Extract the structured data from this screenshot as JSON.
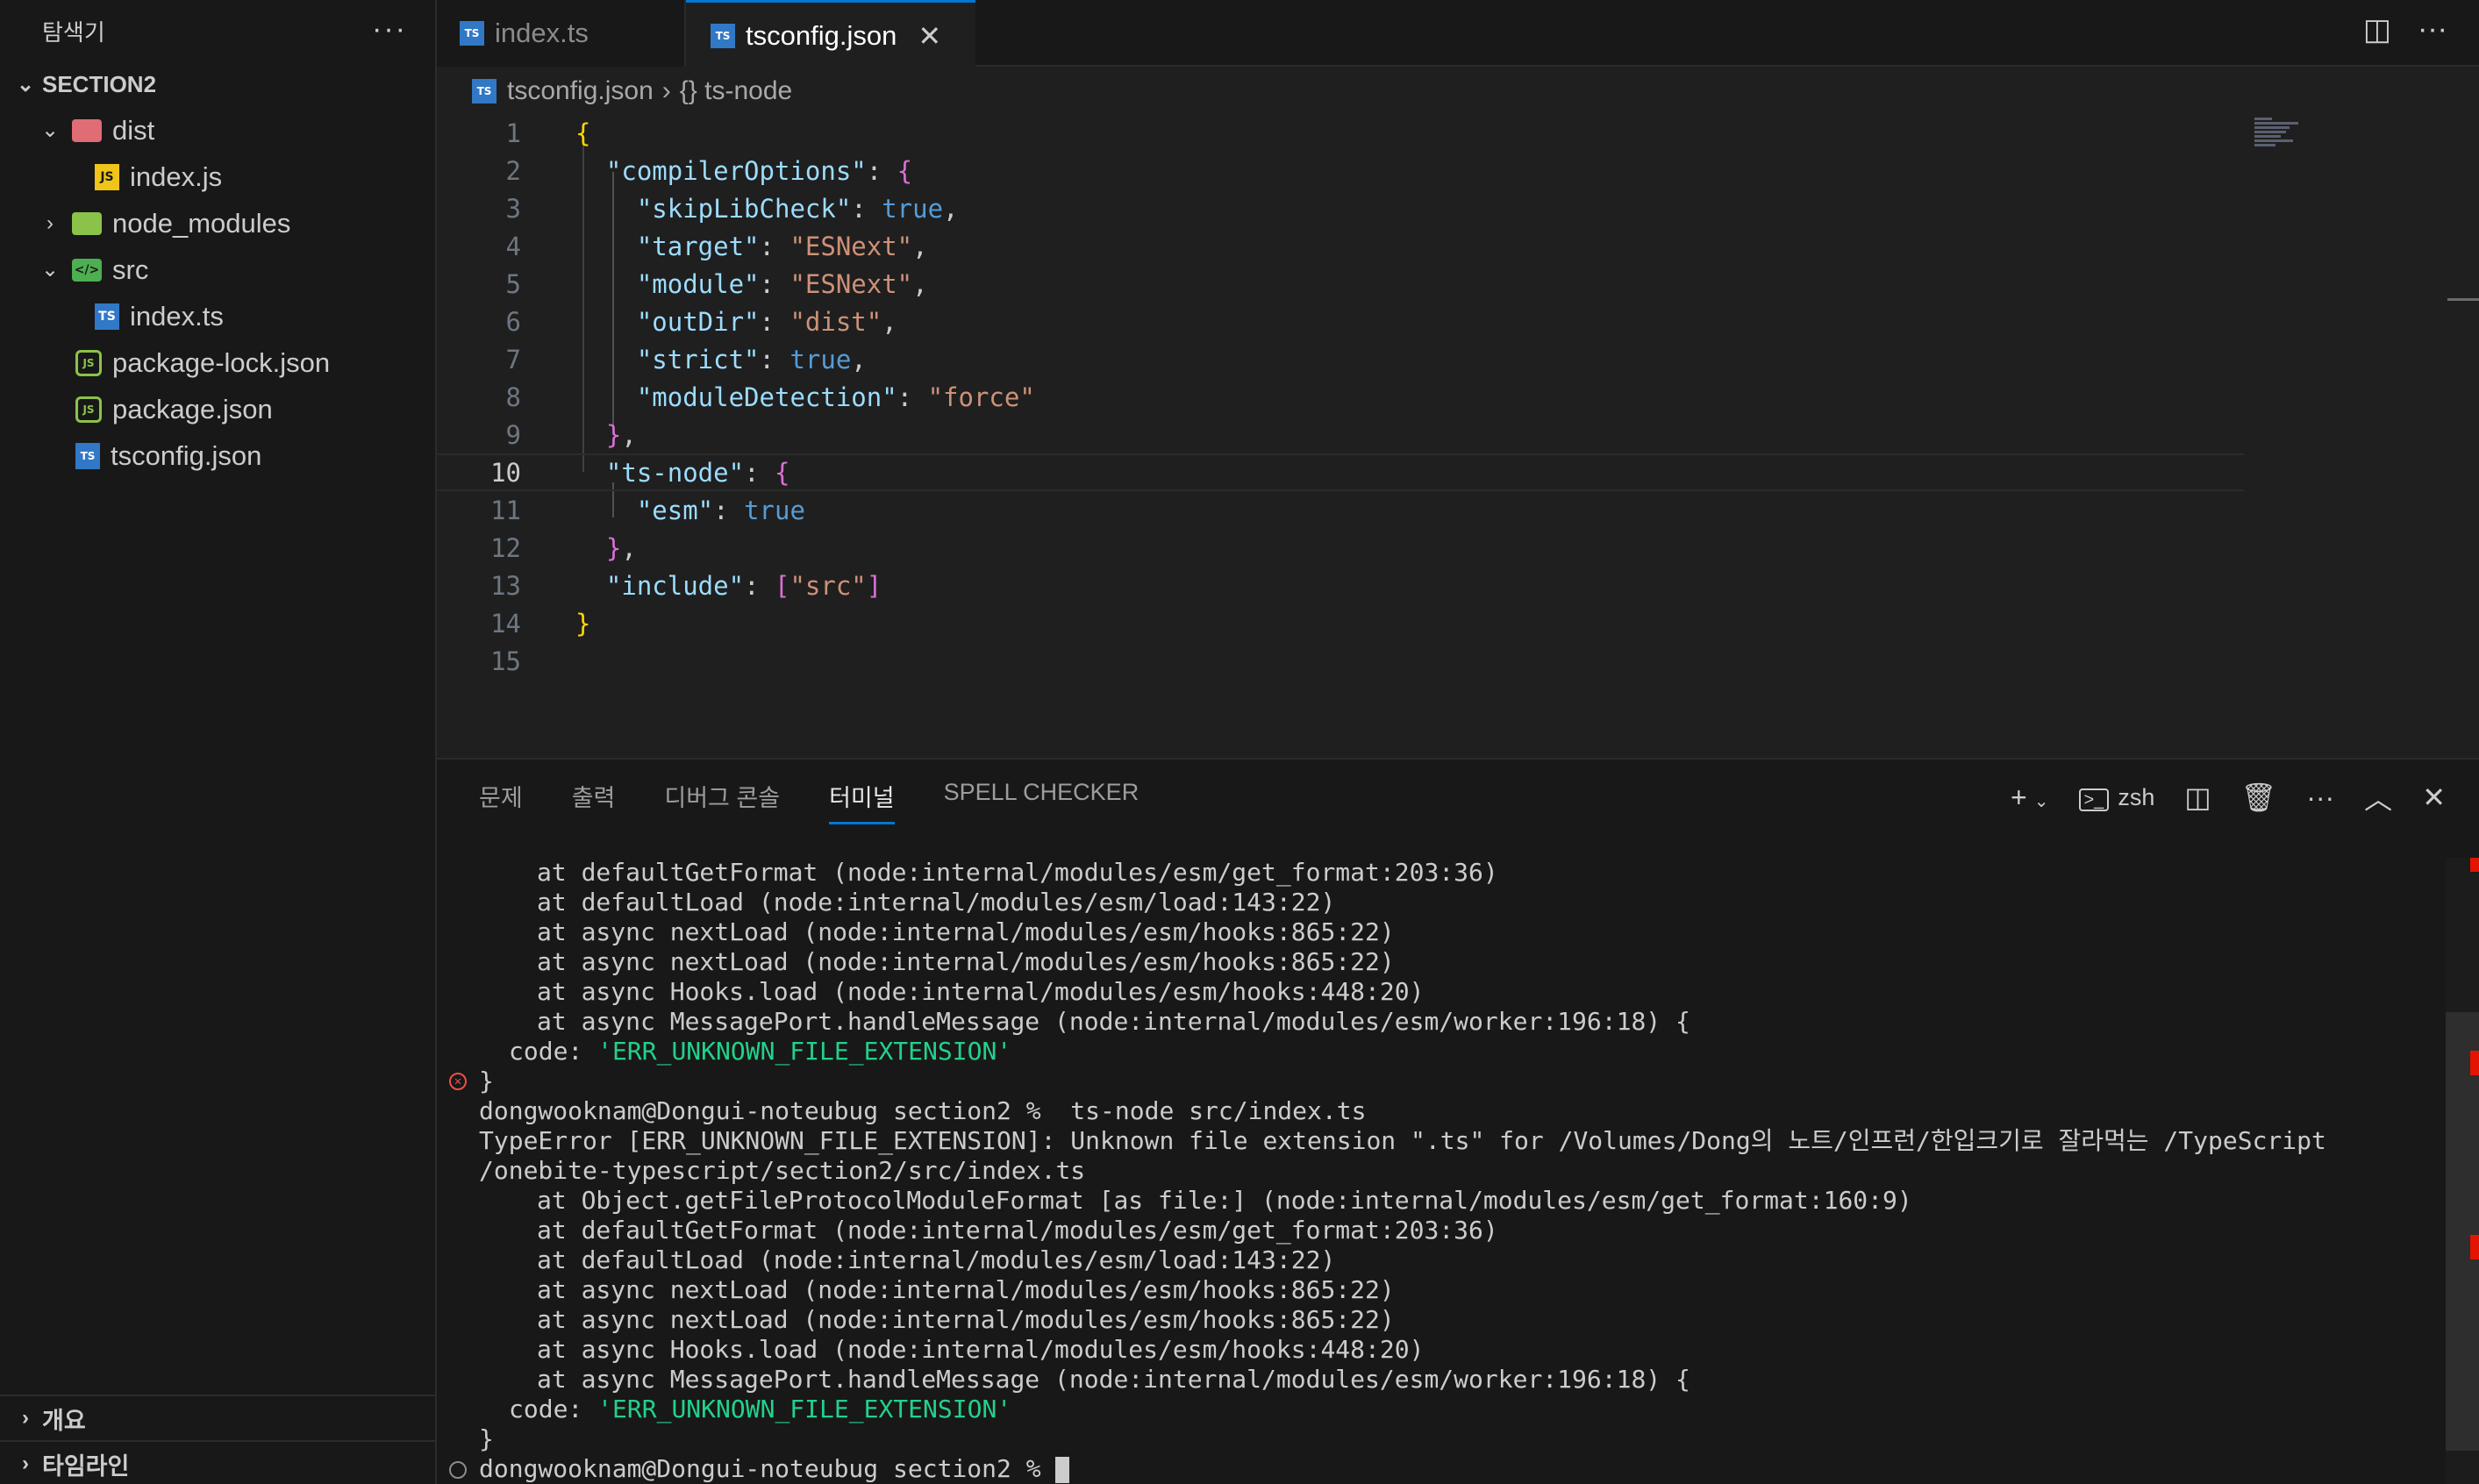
{
  "sidebar": {
    "title": "탐색기",
    "more": "···",
    "section": "SECTION2",
    "items": [
      {
        "label": "dist",
        "icon": "folder-dist-icon"
      },
      {
        "label": "index.js",
        "icon": "js-file-icon"
      },
      {
        "label": "node_modules",
        "icon": "folder-node-icon"
      },
      {
        "label": "src",
        "icon": "folder-src-icon"
      },
      {
        "label": "index.ts",
        "icon": "ts-file-icon"
      },
      {
        "label": "package-lock.json",
        "icon": "node-json-icon"
      },
      {
        "label": "package.json",
        "icon": "node-json-icon"
      },
      {
        "label": "tsconfig.json",
        "icon": "tsconfig-icon"
      }
    ],
    "outline": "개요",
    "timeline": "타임라인"
  },
  "tabs": [
    {
      "label": "index.ts",
      "active": false
    },
    {
      "label": "tsconfig.json",
      "active": true
    }
  ],
  "breadcrumb": {
    "file": "tsconfig.json",
    "symbol": "{} ts-node"
  },
  "editor": {
    "current_line": 10,
    "line_numbers": [
      "1",
      "2",
      "3",
      "4",
      "5",
      "6",
      "7",
      "8",
      "9",
      "10",
      "11",
      "12",
      "13",
      "14",
      "15"
    ],
    "lines": [
      "{",
      "  \"compilerOptions\": {",
      "    \"skipLibCheck\": true,",
      "    \"target\": \"ESNext\",",
      "    \"module\": \"ESNext\",",
      "    \"outDir\": \"dist\",",
      "    \"strict\": true,",
      "    \"moduleDetection\": \"force\"",
      "  },",
      "  \"ts-node\": {",
      "    \"esm\": true",
      "  },",
      "  \"include\": [\"src\"]",
      "}",
      ""
    ]
  },
  "panel": {
    "tabs": [
      "문제",
      "출력",
      "디버그 콘솔",
      "터미널",
      "SPELL CHECKER"
    ],
    "active_tab": "터미널",
    "shell": "zsh",
    "terminal": [
      "at defaultGetFormat (node:internal/modules/esm/get_format:203:36)",
      "at defaultLoad (node:internal/modules/esm/load:143:22)",
      "at async nextLoad (node:internal/modules/esm/hooks:865:22)",
      "at async nextLoad (node:internal/modules/esm/hooks:865:22)",
      "at async Hooks.load (node:internal/modules/esm/hooks:448:20)",
      "at async MessagePort.handleMessage (node:internal/modules/esm/worker:196:18) {",
      "code: ",
      "'ERR_UNKNOWN_FILE_EXTENSION'",
      "}",
      "dongwooknam@Dongui-noteubug section2 %  ts-node src/index.ts",
      "TypeError [ERR_UNKNOWN_FILE_EXTENSION]: Unknown file extension \".ts\" for /Volumes/Dong의 노트/인프런/한입크기로 잘라먹는 /TypeScript",
      "/onebite-typescript/section2/src/index.ts",
      "at Object.getFileProtocolModuleFormat [as file:] (node:internal/modules/esm/get_format:160:9)",
      "at defaultGetFormat (node:internal/modules/esm/get_format:203:36)",
      "at defaultLoad (node:internal/modules/esm/load:143:22)",
      "at async nextLoad (node:internal/modules/esm/hooks:865:22)",
      "at async nextLoad (node:internal/modules/esm/hooks:865:22)",
      "at async Hooks.load (node:internal/modules/esm/hooks:448:20)",
      "at async MessagePort.handleMessage (node:internal/modules/esm/worker:196:18) {",
      "code: ",
      "'ERR_UNKNOWN_FILE_EXTENSION'",
      "}",
      "dongwooknam@Dongui-noteubug section2 % "
    ]
  },
  "colors": {
    "accent": "#0078d4",
    "error": "#f14c4c",
    "string": "#ce9178",
    "keyword": "#569cd6",
    "property": "#9cdcfe",
    "success": "#23d18b"
  }
}
